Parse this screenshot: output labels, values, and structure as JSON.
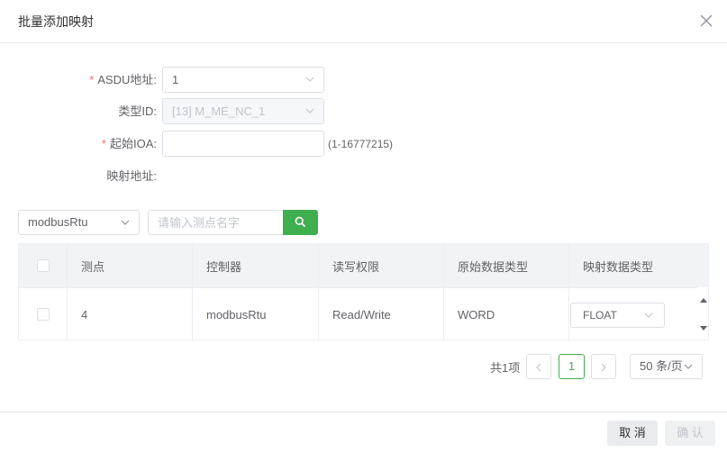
{
  "dialog": {
    "title": "批量添加映射"
  },
  "form": {
    "asdu": {
      "label": "ASDU地址:",
      "required_mark": "*",
      "value": "1"
    },
    "type_id": {
      "label": "类型ID:",
      "value": "[13] M_ME_NC_1"
    },
    "start_ioa": {
      "label": "起始IOA:",
      "required_mark": "*",
      "value": "",
      "hint": "(1-16777215)"
    },
    "mapping_address": {
      "label": "映射地址:"
    }
  },
  "filter": {
    "device_select": "modbusRtu",
    "search_placeholder": "请输入测点名字"
  },
  "table": {
    "columns": [
      "测点",
      "控制器",
      "读写权限",
      "原始数据类型",
      "映射数据类型"
    ],
    "rows": [
      {
        "point": "4",
        "controller": "modbusRtu",
        "access": "Read/Write",
        "raw_type": "WORD",
        "mapped_type": "FLOAT"
      }
    ]
  },
  "pagination": {
    "total": "共1项",
    "current_page": "1",
    "page_size": "50 条/页"
  },
  "footer": {
    "cancel": "取 消",
    "confirm": "确 认"
  },
  "colors": {
    "accent": "#3fae4f",
    "required": "#f56c6c",
    "header_bg": "#f2f3f5"
  }
}
